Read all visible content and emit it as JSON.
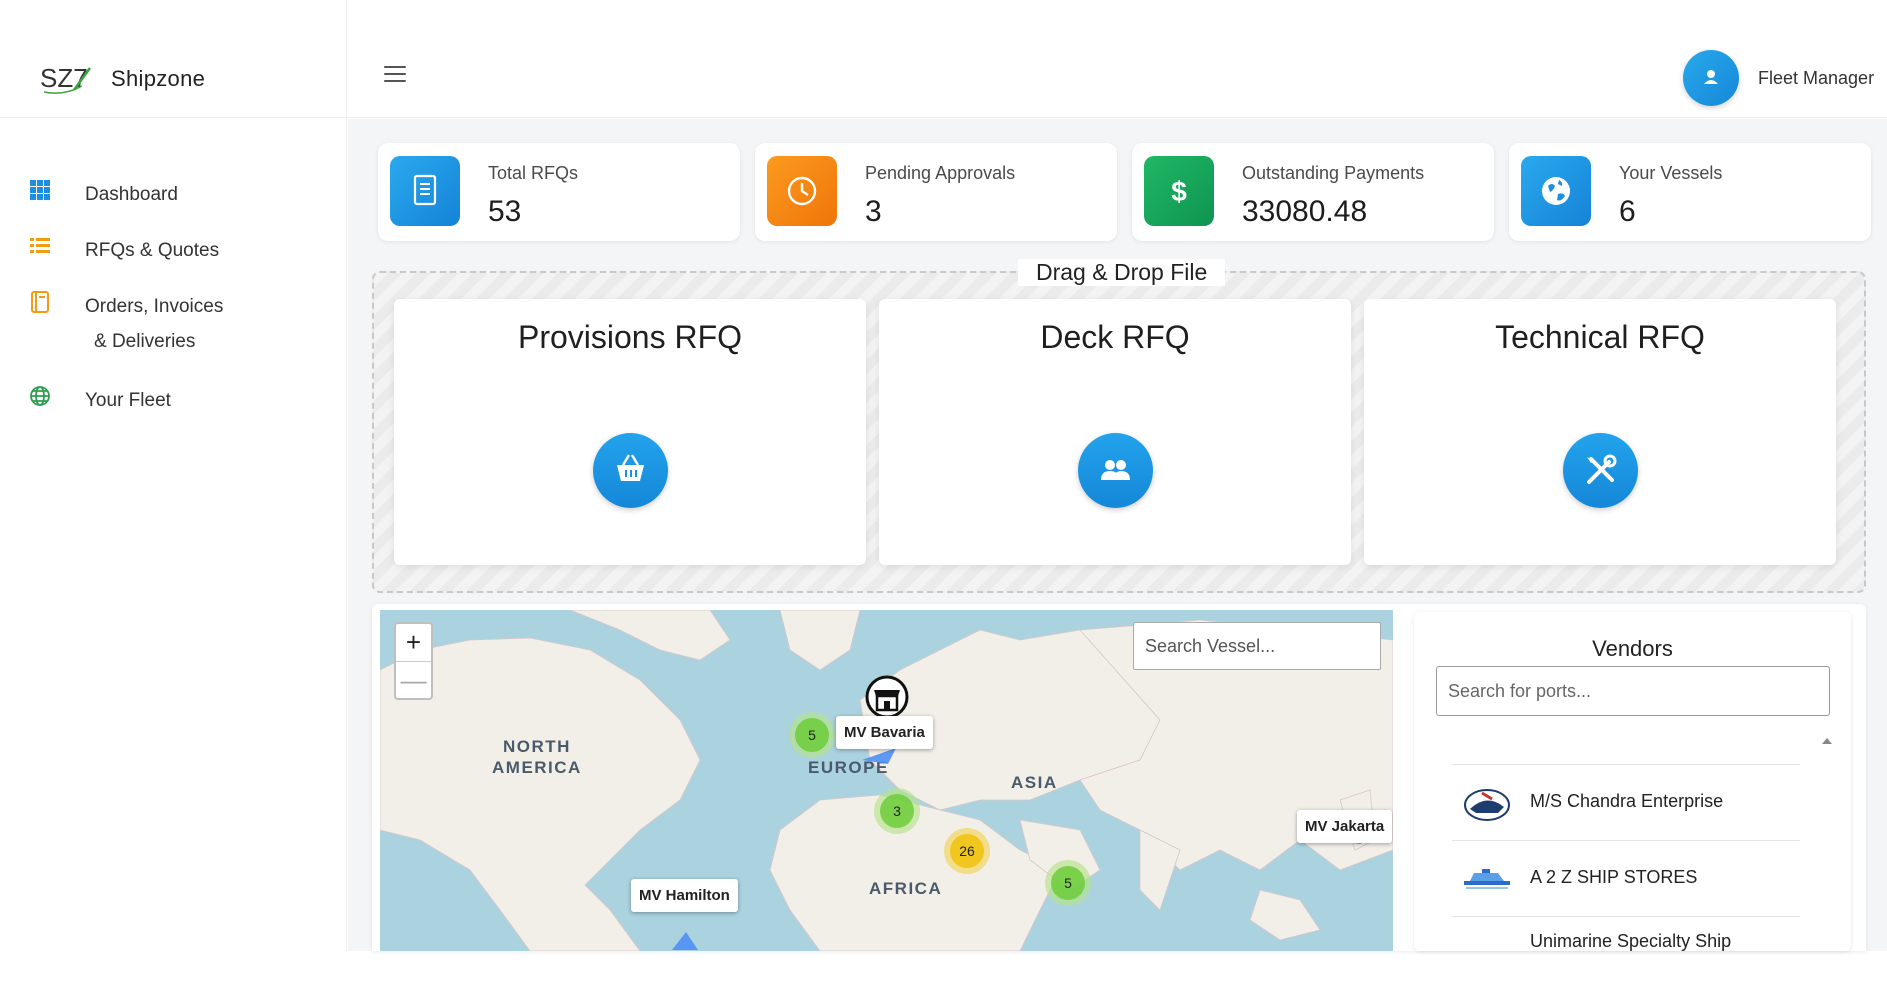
{
  "brand": {
    "logo_text": "SZ7",
    "name": "Shipzone"
  },
  "sidebar": {
    "items": [
      {
        "label": "Dashboard",
        "icon": "grid-icon",
        "color": "#1a8fe3"
      },
      {
        "label": "RFQs & Quotes",
        "icon": "list-icon",
        "color": "#f39c12"
      },
      {
        "label": "Orders, Invoices",
        "label2": "& Deliveries",
        "icon": "book-icon",
        "color": "#f39c12"
      },
      {
        "label": "Your Fleet",
        "icon": "globe-icon",
        "color": "#2e9e4f"
      }
    ]
  },
  "header": {
    "user_name": "Fleet Manager"
  },
  "stats": [
    {
      "label": "Total RFQs",
      "value": "53",
      "icon": "document-icon",
      "color": "#1a8fe3"
    },
    {
      "label": "Pending Approvals",
      "value": "3",
      "icon": "clock-icon",
      "color": "#f7860b"
    },
    {
      "label": "Outstanding Payments",
      "value": "33080.48",
      "icon": "dollar-icon",
      "color": "#15a45b"
    },
    {
      "label": "Your Vessels",
      "value": "6",
      "icon": "globe-icon",
      "color": "#1a8fe3"
    }
  ],
  "dropzone": {
    "title": "Drag & Drop File"
  },
  "rfq_cards": [
    {
      "title": "Provisions RFQ",
      "icon": "basket-icon"
    },
    {
      "title": "Deck RFQ",
      "icon": "users-icon"
    },
    {
      "title": "Technical RFQ",
      "icon": "tools-icon"
    }
  ],
  "map": {
    "zoom_in": "+",
    "zoom_out": "—",
    "search_placeholder": "Search Vessel...",
    "continents": [
      "NORTH",
      "AMERICA",
      "EUROPE",
      "ASIA",
      "AFRICA"
    ],
    "vessels": [
      "MV Bavaria",
      "MV Jakarta",
      "MV Hamilton"
    ],
    "clusters": [
      "5",
      "3",
      "26",
      "5"
    ]
  },
  "vendors": {
    "title": "Vendors",
    "search_placeholder": "Search for ports...",
    "items": [
      {
        "name": "M/S Chandra Enterprise"
      },
      {
        "name": "A 2 Z SHIP STORES"
      },
      {
        "name": "Unimarine Specialty Ship"
      }
    ]
  }
}
